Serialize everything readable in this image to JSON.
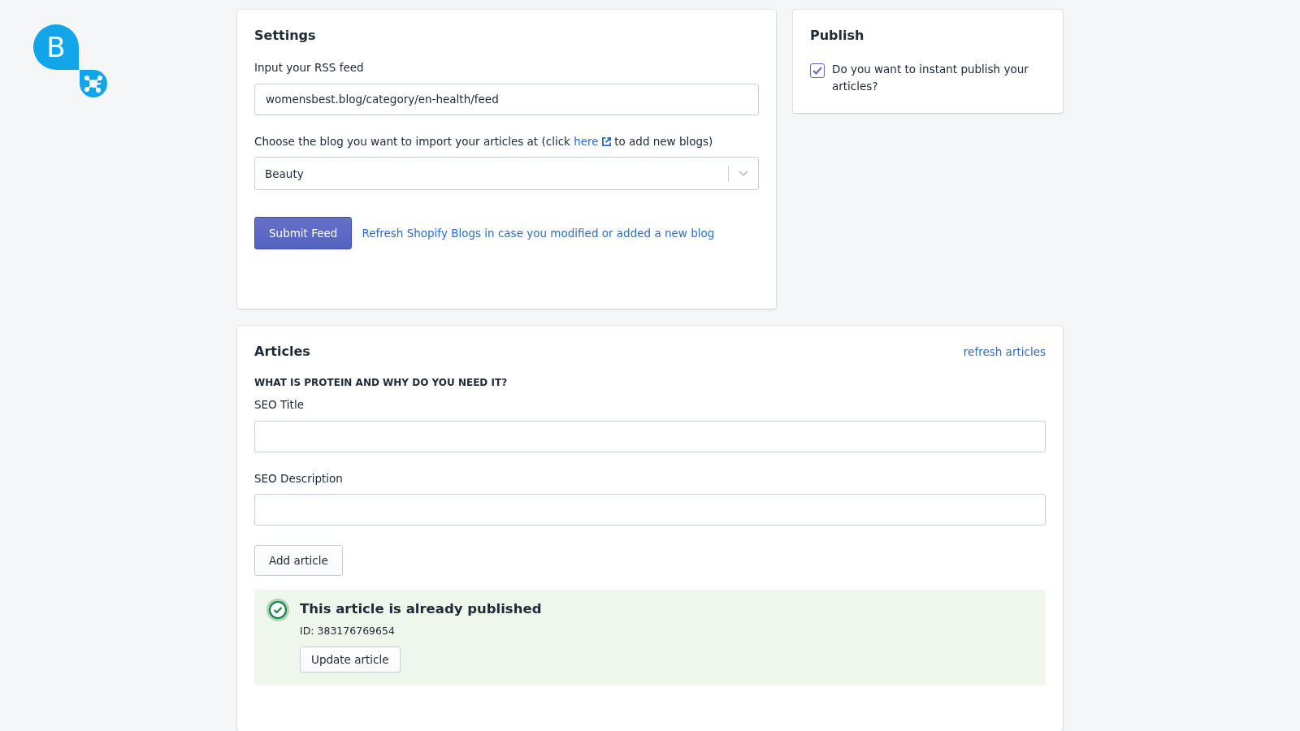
{
  "logo": {
    "letter": "B"
  },
  "settings": {
    "title": "Settings",
    "rss_label": "Input your RSS feed",
    "rss_value": "womensbest.blog/category/en-health/feed",
    "blog_label": {
      "before": "Choose the blog you want to import your articles at (click",
      "link": "here",
      "after": "to add new blogs)"
    },
    "blog_value": "Beauty",
    "submit": "Submit Feed",
    "refresh_link": "Refresh Shopify Blogs in case you modified or added a new blog"
  },
  "publish": {
    "title": "Publish",
    "option": {
      "label": "Do you want to instant publish your articles?",
      "checked": true
    }
  },
  "articles": {
    "title": "Articles",
    "refresh": "refresh articles",
    "article_title": "WHAT IS PROTEIN AND WHY DO YOU NEED IT?",
    "seo_title_label": "SEO Title",
    "seo_description_label": "SEO Description",
    "add_button": "Add article",
    "banner": {
      "published": true,
      "title": "This article is already published",
      "id": "ID: 383176769654",
      "button": "Update article"
    }
  }
}
